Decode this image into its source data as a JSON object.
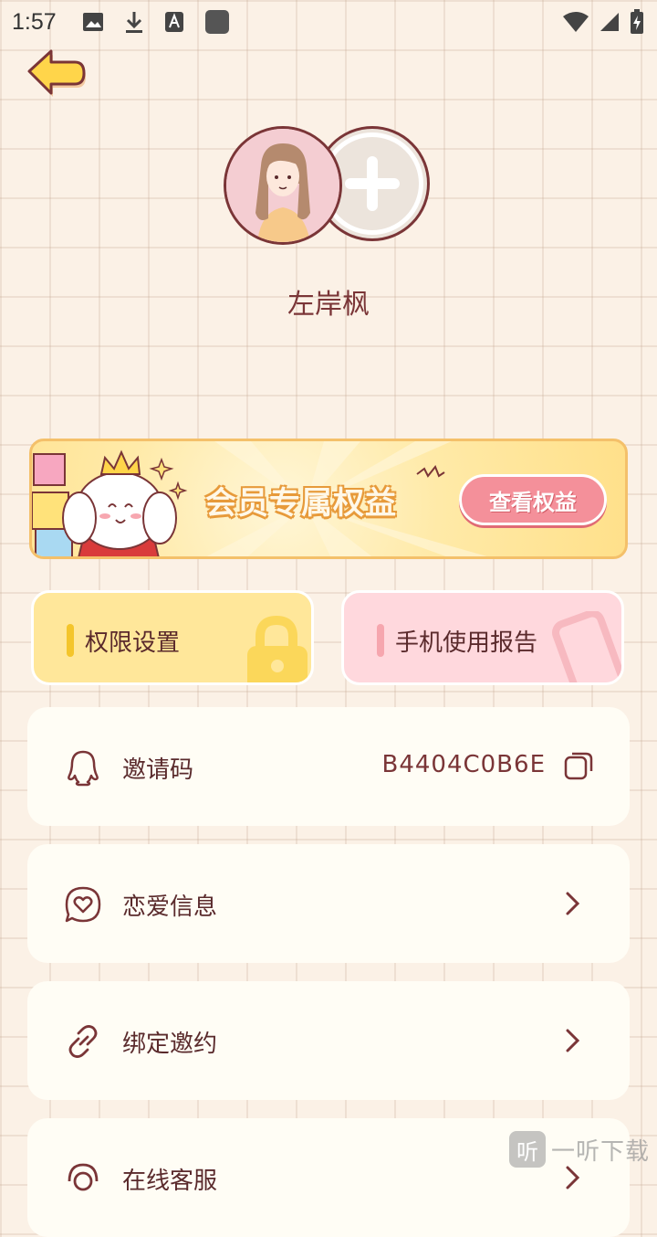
{
  "status_bar": {
    "time": "1:57"
  },
  "profile": {
    "username": "左岸枫"
  },
  "vip_banner": {
    "title": "会员专属权益",
    "button_label": "查看权益"
  },
  "tiles": [
    {
      "label": "权限设置"
    },
    {
      "label": "手机使用报告"
    }
  ],
  "rows": [
    {
      "label": "邀请码",
      "value": "B4404C0B6E",
      "icon": "qq-icon"
    },
    {
      "label": "恋爱信息",
      "icon": "heart-chat-icon"
    },
    {
      "label": "绑定邀约",
      "icon": "link-icon"
    },
    {
      "label": "在线客服",
      "icon": "headset-icon"
    }
  ],
  "watermark": {
    "badge": "听",
    "text": "一听下载"
  },
  "colors": {
    "accent": "#7a3537",
    "background": "#fbf1e6",
    "vip_button": "#f4909a",
    "tile_yellow": "#ffe79a",
    "tile_pink": "#ffd8dd"
  }
}
